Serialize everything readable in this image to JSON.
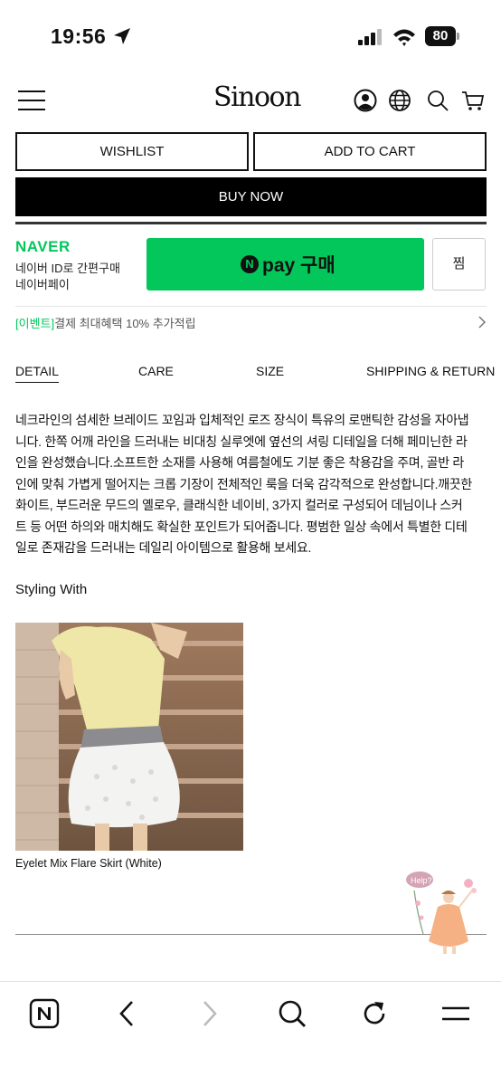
{
  "status_bar": {
    "time": "19:56",
    "battery": "80",
    "icons": [
      "location-arrow-icon",
      "cellular-signal-icon",
      "wifi-icon",
      "battery-icon"
    ]
  },
  "header": {
    "logo": "Sinoon",
    "icons": [
      "menu-icon",
      "account-icon",
      "globe-icon",
      "search-icon",
      "cart-icon"
    ]
  },
  "actions": {
    "wishlist": "WISHLIST",
    "add_to_cart": "ADD TO CART",
    "buy_now": "BUY NOW"
  },
  "naver": {
    "logo": "NAVER",
    "line1": "네이버 ID로 간편구매",
    "line2": "네이버페이",
    "pay_n": "N",
    "pay_label": "pay 구매",
    "zzim": "찜",
    "event_tag": "[이벤트]",
    "event_text": "결제 최대혜택 10% 추가적립",
    "brand_color": "#03c75a"
  },
  "tabs": [
    {
      "label": "DETAIL",
      "active": true
    },
    {
      "label": "CARE",
      "active": false
    },
    {
      "label": "SIZE",
      "active": false
    },
    {
      "label": "SHIPPING & RETURN",
      "active": false
    }
  ],
  "description": [
    "네크라인의 섬세한 브레이드 꼬임과 입체적인 로즈 장식이 특유의 로맨틱한 감성을 자아냅",
    "니다. 한쪽 어깨 라인을 드러내는 비대칭 실루엣에 옆선의 셔링 디테일을 더해 페미닌한 라",
    "인을 완성했습니다.소프트한 소재를 사용해 여름철에도 기분 좋은 착용감을 주며, 골반 라",
    "인에 맞춰 가볍게 떨어지는 크롭 기장이 전체적인 룩을 더욱 감각적으로 완성합니다.깨끗한",
    "화이트, 부드러운 무드의 옐로우, 클래식한 네이비, 3가지 컬러로 구성되어 데님이나 스커",
    "트 등 어떤 하의와 매치해도 확실한 포인트가 되어줍니다. 평범한 일상 속에서 특별한 디테",
    "일로 존재감을 드러내는 데일리 아이템으로 활용해 보세요."
  ],
  "styling": {
    "title": "Styling With",
    "product_caption": "Eyelet Mix Flare Skirt (White)"
  },
  "help_widget": {
    "bubble": "Help?"
  },
  "browser_bar": {
    "icons": [
      "naver-home-icon",
      "back-icon",
      "forward-icon",
      "search-icon",
      "reload-icon",
      "menu-icon"
    ]
  }
}
